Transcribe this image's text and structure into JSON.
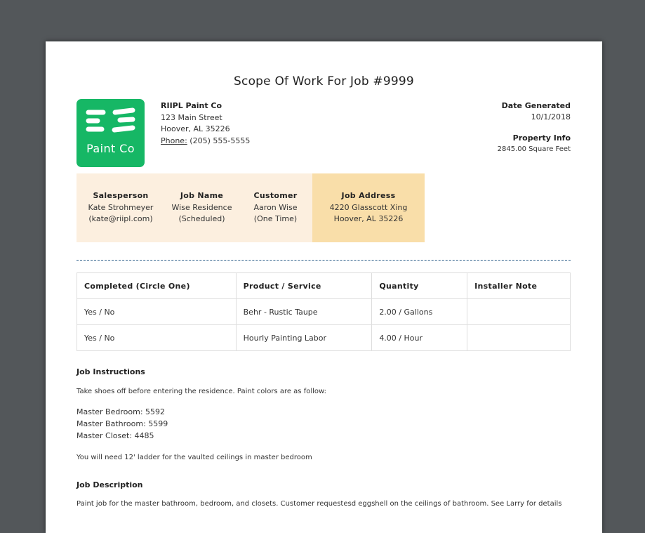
{
  "document": {
    "title": "Scope Of Work For Job #9999"
  },
  "logo": {
    "text": "Paint Co",
    "color": "#16b765"
  },
  "company": {
    "name": "RIIPL Paint Co",
    "street": "123 Main Street",
    "city": "Hoover, AL 35226",
    "phone_label": "Phone:",
    "phone": "(205) 555-5555"
  },
  "meta": {
    "date_label": "Date Generated",
    "date": "10/1/2018",
    "property_label": "Property Info",
    "property": "2845.00 Square Feet"
  },
  "info": {
    "salesperson": {
      "label": "Salesperson",
      "line1": "Kate Strohmeyer",
      "line2": "(kate@riipl.com)"
    },
    "job_name": {
      "label": "Job Name",
      "line1": "Wise Residence",
      "line2": "(Scheduled)"
    },
    "customer": {
      "label": "Customer",
      "line1": "Aaron Wise",
      "line2": "(One Time)"
    },
    "job_address": {
      "label": "Job Address",
      "line1": "4220 Glasscott Xing",
      "line2": "Hoover, AL 35226"
    }
  },
  "table": {
    "headers": [
      "Completed (Circle One)",
      "Product / Service",
      "Quantity",
      "Installer Note"
    ],
    "rows": [
      [
        "Yes / No",
        "Behr - Rustic Taupe",
        "2.00 / Gallons",
        ""
      ],
      [
        "Yes / No",
        "Hourly Painting Labor",
        "4.00 / Hour",
        ""
      ]
    ]
  },
  "instructions": {
    "heading": "Job Instructions",
    "intro": "Take shoes off before entering the residence.  Paint colors are as follow:",
    "colors": [
      "Master Bedroom: 5592",
      "Master Bathroom: 5599",
      "Master Closet: 4485"
    ],
    "note": "You will need 12' ladder for the vaulted ceilings in master bedroom"
  },
  "description": {
    "heading": "Job Description",
    "text": "Paint job for the master bathroom, bedroom, and closets. Customer requestesd eggshell on the ceilings of bathroom. See Larry for details"
  }
}
